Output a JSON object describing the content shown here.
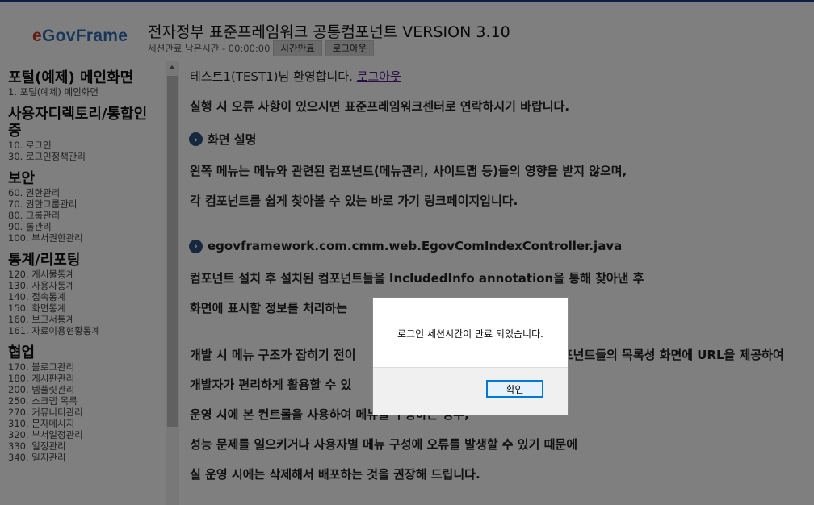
{
  "header": {
    "logo_e": "e",
    "logo_rest": "GovFrame",
    "title": "전자정부 표준프레임워크 공통컴포넌트 VERSION 3.10",
    "session_label": "세션만료 남은시간 - 00:00:00",
    "extend_button": "시간만료",
    "logout_button": "로그아웃"
  },
  "sidebar": {
    "sections": [
      {
        "title": "포털(예제) 메인화면",
        "items": [
          "1. 포털(예제) 메인화면"
        ]
      },
      {
        "title": "사용자디렉토리/통합인증",
        "items": [
          "10. 로그인",
          "30. 로그인정책관리"
        ]
      },
      {
        "title": "보안",
        "items": [
          "60. 권한관리",
          "70. 권한그룹관리",
          "80. 그룹관리",
          "90. 롤관리",
          "100. 부서권한관리"
        ]
      },
      {
        "title": "통계/리포팅",
        "items": [
          "120. 게시물통계",
          "130. 사용자통계",
          "140. 접속통계",
          "150. 화면통계",
          "160. 보고서통계",
          "161. 자료이용현황통계"
        ]
      },
      {
        "title": "협업",
        "items": [
          "170. 블로그관리",
          "180. 게시판관리",
          "200. 템플릿관리",
          "250. 스크랩 목록",
          "270. 커뮤니티관리",
          "310. 문자메시지",
          "320. 부서일정관리",
          "330. 일정관리",
          "340. 일지관리"
        ]
      }
    ]
  },
  "content": {
    "welcome_text": "테스트1(TEST1)님 환영합니다.",
    "logout_link": "로그아웃",
    "notice": "실행 시 오류 사항이 있으시면 표준프레임워크센터로 연락하시기 바랍니다.",
    "heading1": "화면 설명",
    "p1": "왼쪽 메뉴는 메뉴와 관련된 컴포넌트(메뉴관리, 사이트맵 등)들의 영향을 받지 않으며,",
    "p2": "각 컴포넌트를 쉽게 찾아볼 수 있는 바로 가기 링크페이지입니다.",
    "heading2": "egovframework.com.cmm.web.EgovComIndexController.java",
    "p3": "컴포넌트 설치 후 설치된 컴포넌트들을 IncludedInfo annotation을 통해 찾아낸 후",
    "p4": "화면에 표시할 정보를 처리하는",
    "p5_start": "개발 시 메뉴 구조가 잡히기 전이",
    "p5_end": "컴포넌트들의 목록성 화면에 URL을 제공하여",
    "p6": "개발자가 편리하게 활용할 수 있",
    "p7": "운영 시에 본 컨트롤을 사용하여 메뉴를 구성하는 경우,",
    "p8": "성능 문제를 일으키거나 사용자별 메뉴 구성에 오류를 발생할 수 있기 때문에",
    "p9": "실 운영 시에는 삭제해서 배포하는 것을 권장해 드립니다."
  },
  "dialog": {
    "message": "로그인 세션시간이 만료 되었습니다.",
    "ok_button": "확인"
  }
}
